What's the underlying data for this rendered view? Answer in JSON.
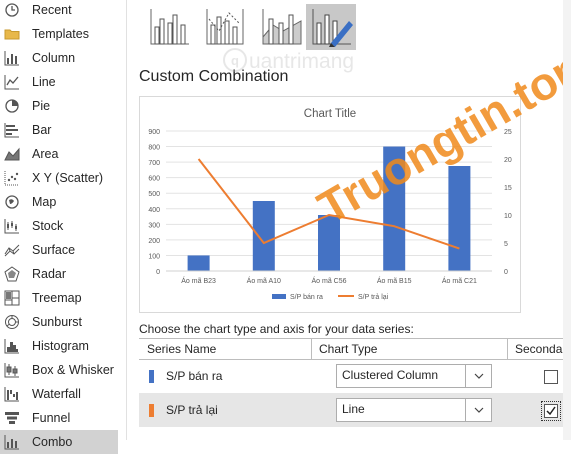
{
  "sidebar": {
    "items": [
      {
        "label": "Recent",
        "icon": "clock-icon"
      },
      {
        "label": "Templates",
        "icon": "folder-icon"
      },
      {
        "label": "Column",
        "icon": "column-chart-icon"
      },
      {
        "label": "Line",
        "icon": "line-chart-icon"
      },
      {
        "label": "Pie",
        "icon": "pie-chart-icon"
      },
      {
        "label": "Bar",
        "icon": "bar-chart-icon"
      },
      {
        "label": "Area",
        "icon": "area-chart-icon"
      },
      {
        "label": "X Y (Scatter)",
        "icon": "scatter-chart-icon"
      },
      {
        "label": "Map",
        "icon": "map-chart-icon"
      },
      {
        "label": "Stock",
        "icon": "stock-chart-icon"
      },
      {
        "label": "Surface",
        "icon": "surface-chart-icon"
      },
      {
        "label": "Radar",
        "icon": "radar-chart-icon"
      },
      {
        "label": "Treemap",
        "icon": "treemap-chart-icon"
      },
      {
        "label": "Sunburst",
        "icon": "sunburst-chart-icon"
      },
      {
        "label": "Histogram",
        "icon": "histogram-chart-icon"
      },
      {
        "label": "Box & Whisker",
        "icon": "box-whisker-chart-icon"
      },
      {
        "label": "Waterfall",
        "icon": "waterfall-chart-icon"
      },
      {
        "label": "Funnel",
        "icon": "funnel-chart-icon"
      },
      {
        "label": "Combo",
        "icon": "combo-chart-icon"
      }
    ]
  },
  "combo_types": [
    {
      "icon": "clustered-column-line-icon"
    },
    {
      "icon": "clustered-column-line-secondary-axis-icon"
    },
    {
      "icon": "stacked-area-clustered-column-icon"
    },
    {
      "icon": "custom-combination-icon"
    }
  ],
  "heading": "Custom Combination",
  "chart_data": {
    "type": "bar",
    "title": "Chart Title",
    "categories": [
      "Áo mã B23",
      "Áo mã A10",
      "Áo mã C56",
      "Áo mã B15",
      "Áo mã C21"
    ],
    "series": [
      {
        "name": "S/P bán ra",
        "type": "column",
        "axis": "primary",
        "color": "#4472c4",
        "values": [
          100,
          450,
          360,
          800,
          675
        ]
      },
      {
        "name": "S/P trả lại",
        "type": "line",
        "axis": "secondary",
        "color": "#ed7d31",
        "values": [
          20,
          5,
          10,
          8,
          4
        ]
      }
    ],
    "ylim": [
      0,
      900
    ],
    "yticks": [
      "0",
      "100",
      "200",
      "300",
      "400",
      "500",
      "600",
      "700",
      "800",
      "900"
    ],
    "y2lim": [
      0,
      25
    ],
    "y2ticks": [
      "0",
      "5",
      "10",
      "15",
      "20",
      "25"
    ],
    "legend": "bottom",
    "grid": true
  },
  "instruction": "Choose the chart type and axis for your data series:",
  "table": {
    "headers": {
      "name": "Series Name",
      "type": "Chart Type",
      "secondary": "Secondary Axis"
    },
    "rows": [
      {
        "name": "S/P bán ra",
        "color": "#4472c4",
        "chart_type": "Clustered Column",
        "secondary": false
      },
      {
        "name": "S/P trả lại",
        "color": "#ed7d31",
        "chart_type": "Line",
        "secondary": true
      }
    ]
  },
  "watermark": {
    "text": "Truongtin.top",
    "brand": "uantrimang"
  }
}
